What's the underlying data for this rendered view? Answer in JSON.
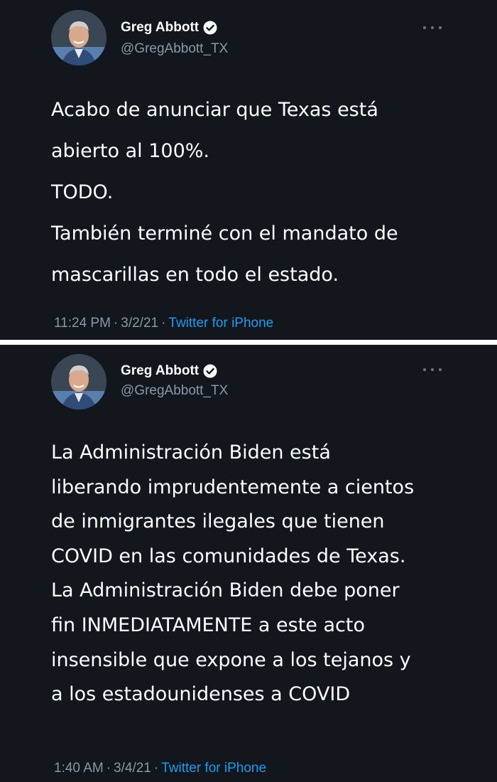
{
  "tweets": [
    {
      "author": {
        "display_name": "Greg Abbott",
        "handle": "@GregAbbott_TX",
        "verified_icon": "verified-badge-icon",
        "avatar_icon": "avatar-photo"
      },
      "body_lines": [
        "Acabo de anunciar que Texas está",
        "abierto al 100%.",
        "TODO.",
        "También terminé con el mandato de",
        "mascarillas en todo el estado."
      ],
      "time": "11:24 PM",
      "date": "3/2/21",
      "separator": "·",
      "source": "Twitter for iPhone"
    },
    {
      "author": {
        "display_name": "Greg Abbott",
        "handle": "@GregAbbott_TX",
        "verified_icon": "verified-badge-icon",
        "avatar_icon": "avatar-photo"
      },
      "body_lines": [
        "La Administración Biden está",
        "liberando imprudentemente a cientos",
        "de inmigrantes ilegales que tienen",
        "COVID en las comunidades de Texas.",
        "La Administración Biden debe poner",
        "fin INMEDIATAMENTE a este acto",
        "insensible que expone a los tejanos y",
        "a los estadounidenses a COVID"
      ],
      "time": "1:40 AM",
      "date": "3/4/21",
      "separator": "·",
      "source": "Twitter for iPhone"
    }
  ],
  "colors": {
    "background": "#12161d",
    "text": "#ffffff",
    "secondary_text": "#8b98a5",
    "link": "#1d9bf0",
    "divider": "#ffffff"
  }
}
